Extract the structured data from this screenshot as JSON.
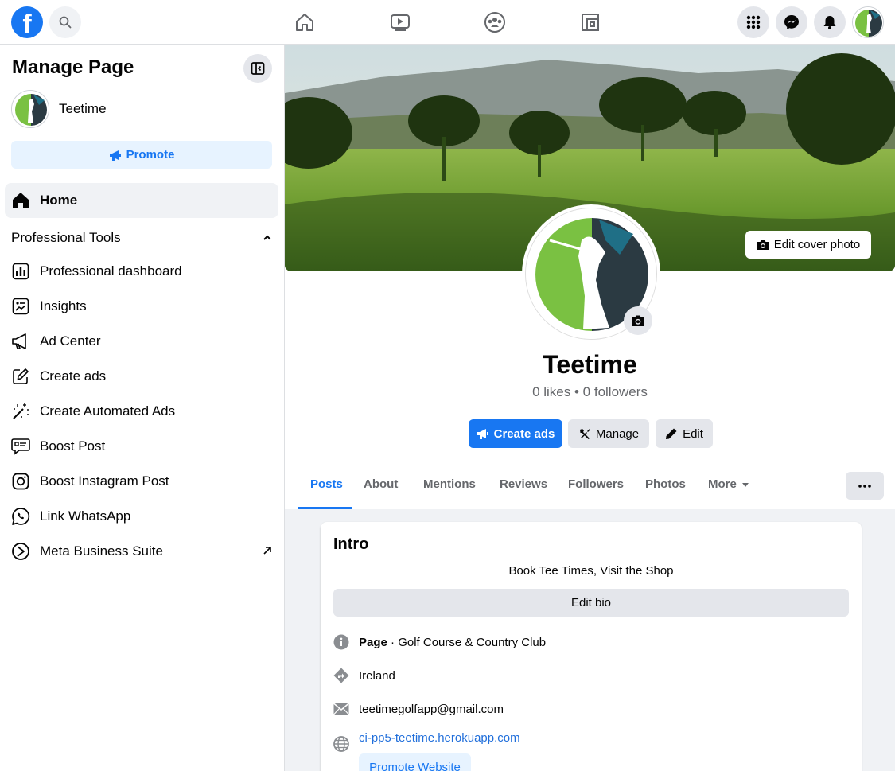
{
  "topbar": {
    "logo_letter": "f",
    "brand_color": "#1877f2"
  },
  "sidebar": {
    "title": "Manage Page",
    "page_name": "Teetime",
    "promote_label": "Promote",
    "home_label": "Home",
    "section_label": "Professional Tools",
    "items": [
      {
        "label": "Professional dashboard",
        "icon": "dashboard-icon"
      },
      {
        "label": "Insights",
        "icon": "insights-icon"
      },
      {
        "label": "Ad Center",
        "icon": "megaphone-icon"
      },
      {
        "label": "Create ads",
        "icon": "pencil-square-icon"
      },
      {
        "label": "Create Automated Ads",
        "icon": "magic-wand-icon"
      },
      {
        "label": "Boost Post",
        "icon": "boost-post-icon"
      },
      {
        "label": "Boost Instagram Post",
        "icon": "instagram-icon"
      },
      {
        "label": "Link WhatsApp",
        "icon": "whatsapp-icon"
      },
      {
        "label": "Meta Business Suite",
        "icon": "business-suite-icon"
      }
    ]
  },
  "profile": {
    "edit_cover_label": "Edit cover photo",
    "name": "Teetime",
    "stats": "0 likes • 0 followers",
    "create_ads_label": "Create ads",
    "manage_label": "Manage",
    "edit_label": "Edit"
  },
  "tabs": [
    "Posts",
    "About",
    "Mentions",
    "Reviews",
    "Followers",
    "Photos",
    "More"
  ],
  "intro": {
    "title": "Intro",
    "bio": "Book Tee Times, Visit the Shop",
    "edit_bio_label": "Edit bio",
    "page_type_bold": "Page",
    "page_type_rest": " · Golf Course & Country Club",
    "location": "Ireland",
    "email": "teetimegolfapp@gmail.com",
    "website": "ci-pp5-teetime.herokuapp.com",
    "promote_website_label": "Promote Website"
  }
}
